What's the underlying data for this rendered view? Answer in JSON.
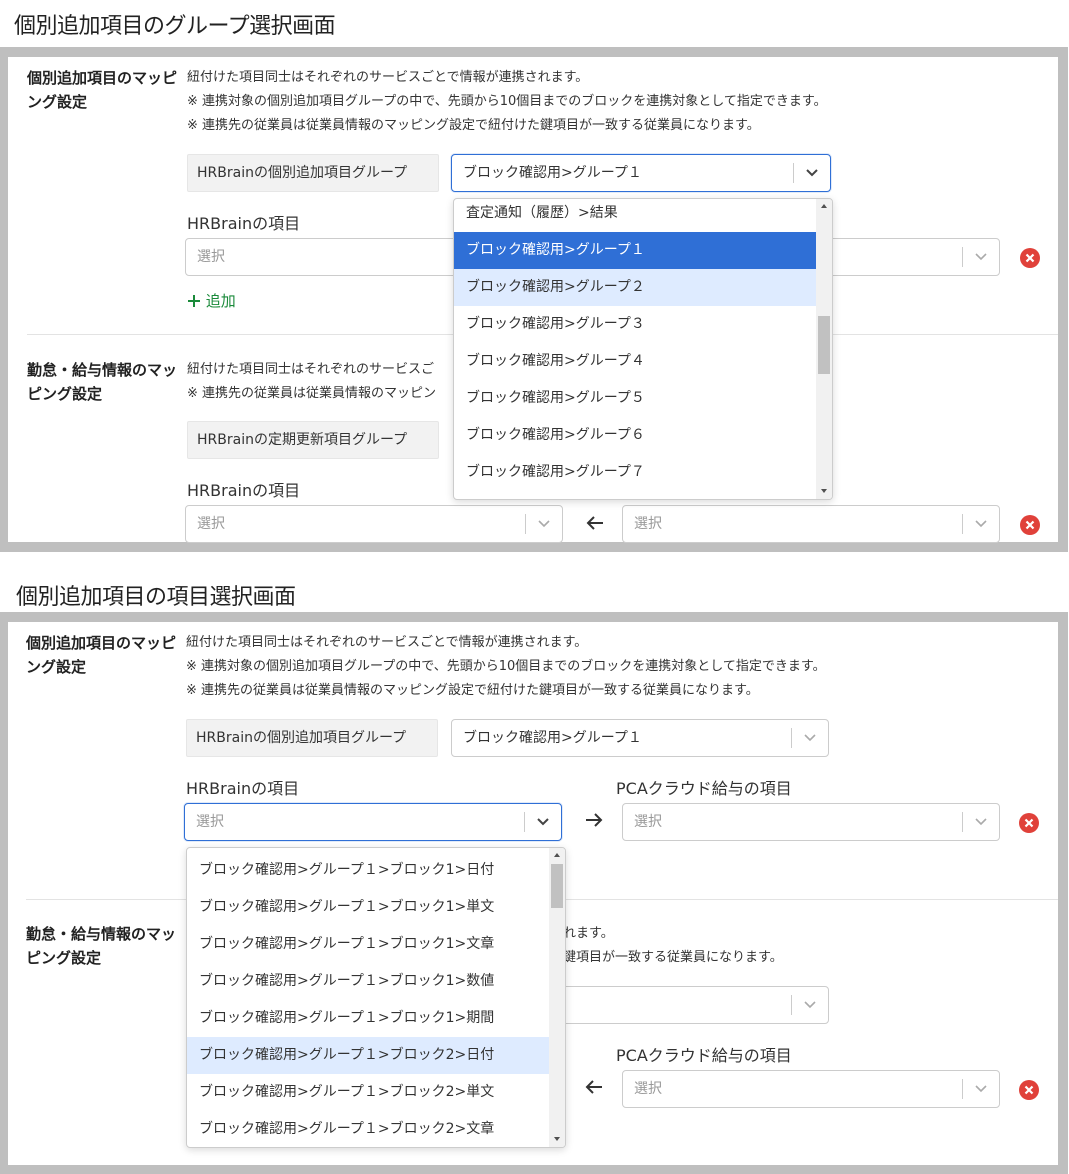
{
  "screen1": {
    "title": "個別追加項目のグループ選択画面",
    "section1": {
      "title": "個別追加項目のマッピング設定",
      "desc": [
        "紐付けた項目同士はそれぞれのサービスごとで情報が連携されます。",
        "※ 連携対象の個別追加項目グループの中で、先頭から10個目までのブロックを連携対象として指定できます。",
        "※ 連携先の従業員は従業員情報のマッピング設定で紐付けた鍵項目が一致する従業員になります。"
      ],
      "group_label": "HRBrainの個別追加項目グループ",
      "group_value": "ブロック確認用>グループ１",
      "item_label": "HRBrainの項目",
      "select_placeholder": "選択",
      "add_label": "追加",
      "dropdown_options": [
        "査定通知（履歴）>結果",
        "ブロック確認用>グループ１",
        "ブロック確認用>グループ２",
        "ブロック確認用>グループ３",
        "ブロック確認用>グループ４",
        "ブロック確認用>グループ５",
        "ブロック確認用>グループ６",
        "ブロック確認用>グループ７"
      ],
      "selected_option": "ブロック確認用>グループ１",
      "hovered_option": "ブロック確認用>グループ２"
    },
    "section2": {
      "title": "勤怠・給与情報のマッピング設定",
      "desc": [
        "紐付けた項目同士はそれぞれのサービスご",
        "※ 連携先の従業員は従業員情報のマッピン"
      ],
      "group_label": "HRBrainの定期更新項目グループ",
      "item_label": "HRBrainの項目",
      "select_placeholder": "選択",
      "target_placeholder": "選択"
    }
  },
  "screen2": {
    "title": "個別追加項目の項目選択画面",
    "section1": {
      "title": "個別追加項目のマッピング設定",
      "desc": [
        "紐付けた項目同士はそれぞれのサービスごとで情報が連携されます。",
        "※ 連携対象の個別追加項目グループの中で、先頭から10個目までのブロックを連携対象として指定できます。",
        "※ 連携先の従業員は従業員情報のマッピング設定で紐付けた鍵項目が一致する従業員になります。"
      ],
      "group_label": "HRBrainの個別追加項目グループ",
      "group_value": "ブロック確認用>グループ１",
      "item_label": "HRBrainの項目",
      "target_label": "PCAクラウド給与の項目",
      "select_placeholder": "選択",
      "target_placeholder": "選択",
      "dropdown_options": [
        "ブロック確認用>グループ１>ブロック1>日付",
        "ブロック確認用>グループ１>ブロック1>単文",
        "ブロック確認用>グループ１>ブロック1>文章",
        "ブロック確認用>グループ１>ブロック1>数値",
        "ブロック確認用>グループ１>ブロック1>期間",
        "ブロック確認用>グループ１>ブロック2>日付",
        "ブロック確認用>グループ１>ブロック2>単文",
        "ブロック確認用>グループ１>ブロック2>文章"
      ],
      "hovered_option": "ブロック確認用>グループ１>ブロック2>日付"
    },
    "section2": {
      "title": "勤怠・給与情報のマッピング設定",
      "desc": [
        "れます。",
        "鍵項目が一致する従業員になります。"
      ],
      "target_label": "PCAクラウド給与の項目",
      "target_placeholder": "選択"
    }
  },
  "colors": {
    "frame": "#bfbfbf",
    "focus": "#2f6fd6",
    "selected": "#2f6fd6",
    "hover": "#deebff",
    "delete": "#e0413a",
    "add": "#1a8a3a"
  },
  "icons": {
    "chevron": "chevron-down-icon",
    "arrow_right": "arrow-right-icon",
    "arrow_left": "arrow-left-icon",
    "delete": "delete-circle-icon",
    "add": "plus-icon"
  }
}
